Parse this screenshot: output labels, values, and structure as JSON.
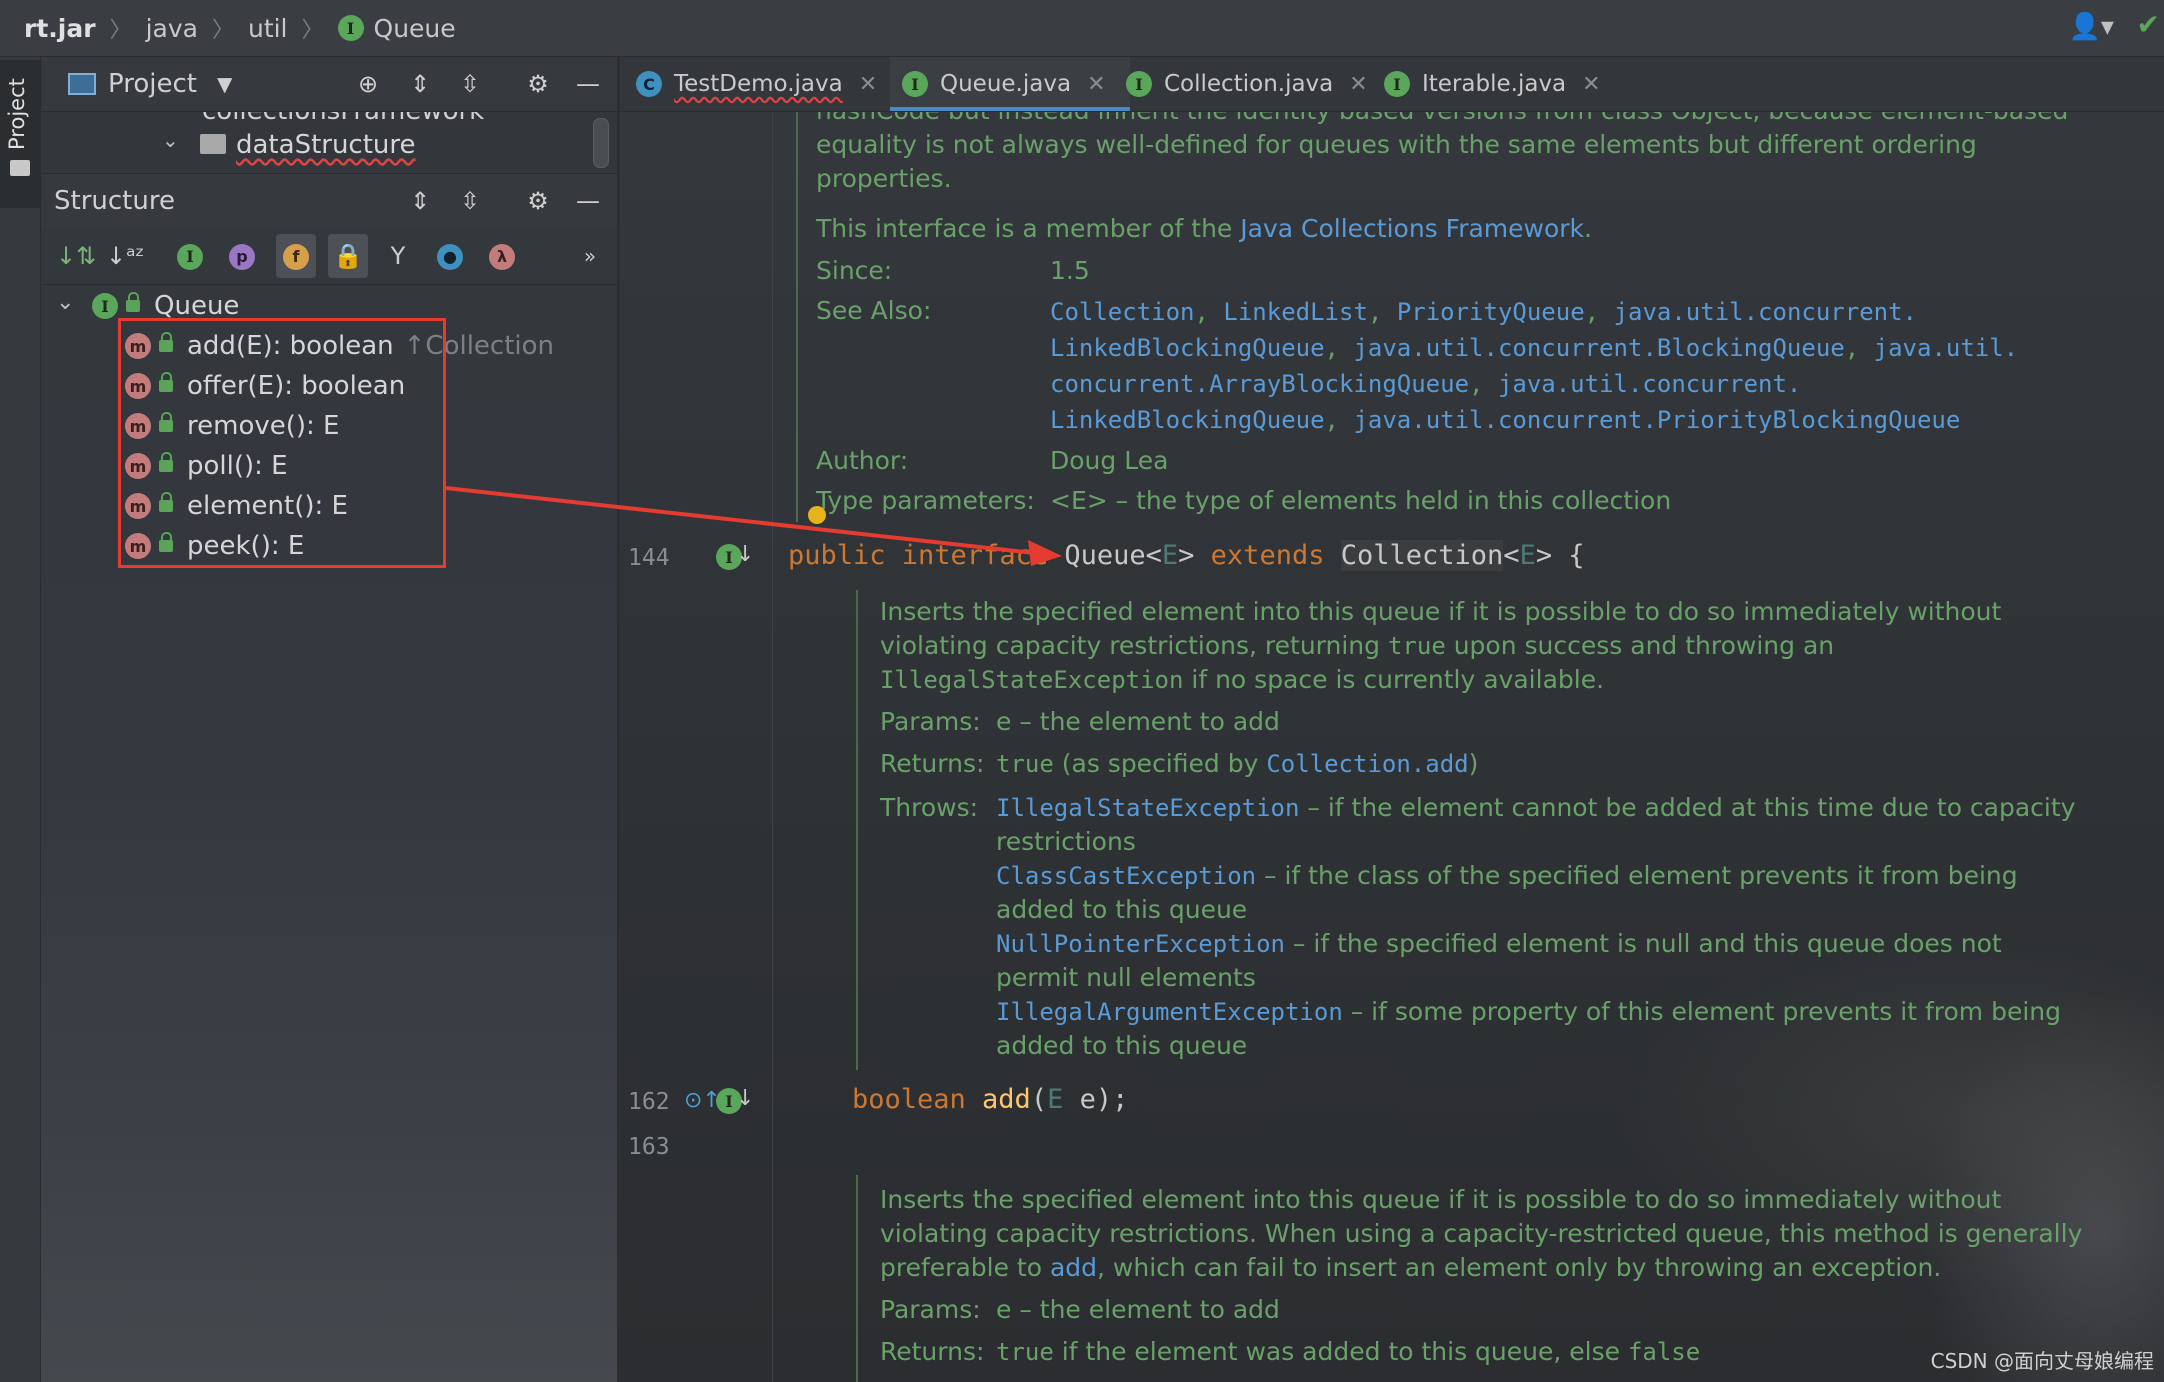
{
  "breadcrumb": {
    "items": [
      "rt.jar",
      "java",
      "util",
      "Queue"
    ]
  },
  "project_panel": {
    "vertical_tab": "Project",
    "title": "Project",
    "tree": {
      "folder_partial": "collectionsFramework",
      "folder": "dataStructure"
    }
  },
  "structure_panel": {
    "title": "Structure",
    "toolbar_icons": [
      "sort-by-visibility-icon",
      "sort-alphabetically-icon",
      "show-inherited-icon",
      "show-properties-icon",
      "show-fields-icon",
      "show-non-public-icon",
      "show-lambdas-tree-icon",
      "anonymous-classes-icon",
      "lambdas-icon",
      "more-icon"
    ],
    "toolbar_glyphs": {
      "props": "p",
      "fields": "f",
      "lambda": "λ"
    },
    "root": "Queue",
    "methods": [
      {
        "sig": "add(E): boolean",
        "inherited": "↑Collection"
      },
      {
        "sig": "offer(E): boolean"
      },
      {
        "sig": "remove(): E"
      },
      {
        "sig": "poll(): E"
      },
      {
        "sig": "element(): E"
      },
      {
        "sig": "peek(): E"
      }
    ]
  },
  "tabs": [
    {
      "label": "TestDemo.java",
      "kind": "C",
      "active": false
    },
    {
      "label": "Queue.java",
      "kind": "I",
      "active": true
    },
    {
      "label": "Collection.java",
      "kind": "I",
      "active": false
    },
    {
      "label": "Iterable.java",
      "kind": "I",
      "active": false
    }
  ],
  "editor": {
    "doc_top": {
      "line1": "hashCode but instead inherit the identity based versions from class Object, because element-based",
      "line2": "equality is not always well-defined for queues with the same elements but different ordering",
      "line3": "properties.",
      "member_prefix": "This interface is a member of the ",
      "member_link": "Java Collections Framework",
      "member_suffix": ".",
      "since_label": "Since:",
      "since_value": "1.5",
      "see_also_label": "See Also:",
      "see_also_1": [
        "Collection",
        "LinkedList",
        "PriorityQueue",
        "java.util.concurrent."
      ],
      "see_also_2": [
        "LinkedBlockingQueue",
        "java.util.concurrent.BlockingQueue",
        "java.util."
      ],
      "see_also_3": [
        "concurrent.ArrayBlockingQueue",
        "java.util.concurrent."
      ],
      "see_also_4": [
        "LinkedBlockingQueue",
        "java.util.concurrent.PriorityBlockingQueue"
      ],
      "sep": ", ",
      "author_label": "Author:",
      "author_value": "Doug Lea",
      "type_params_label": "Type parameters:",
      "type_params_value": "<E> – the type of elements held in this collection"
    },
    "decl_line_no": "144",
    "decl": {
      "kw1": "public interface ",
      "name": "Queue",
      "lt": "<",
      "gen": "E",
      "gt": "> ",
      "kw2": "extends ",
      "parent": "Collection",
      "lt2": "<",
      "gen2": "E",
      "gt2": "> {"
    },
    "doc_add": {
      "l1": "Inserts the specified element into this queue if it is possible to do so immediately without",
      "l2a": "violating capacity restrictions, returning ",
      "l2b": "true",
      "l2c": " upon success and throwing an",
      "l3a": "IllegalStateException",
      "l3b": " if no space is currently available.",
      "params_label": "Params:",
      "params_value": "e – the element to add",
      "returns_label": "Returns:",
      "returns_a": "true",
      "returns_b": " (as specified by ",
      "returns_link": "Collection.add",
      "returns_c": ")",
      "throws_label": "Throws:",
      "t1_link": "IllegalStateException",
      "t1_a": " – if the element cannot be added at this time due to capacity",
      "t1_b": "restrictions",
      "t2_link": "ClassCastException",
      "t2_a": " – if the class of the specified element prevents it from being",
      "t2_b": "added to this queue",
      "t3_link": "NullPointerException",
      "t3_a": " – if the specified element is null and this queue does not",
      "t3_b": "permit null elements",
      "t4_link": "IllegalArgumentException",
      "t4_a": " – if some property of this element prevents it from being",
      "t4_b": "added to this queue"
    },
    "add_line_no": "162",
    "add_code": {
      "kw": "boolean ",
      "fn": "add",
      "open": "(",
      "gen": "E",
      "rest": " e);"
    },
    "empty_line_no": "163",
    "doc_offer": {
      "l1": "Inserts the specified element into this queue if it is possible to do so immediately without",
      "l2": "violating capacity restrictions. When using a capacity-restricted queue, this method is generally",
      "l3a": "preferable to ",
      "l3_link": "add",
      "l3b": ", which can fail to insert an element only by throwing an exception.",
      "params_label": "Params:",
      "params_value": "e – the element to add",
      "returns_label": "Returns:",
      "returns_a": "true",
      "returns_b": " if the element was added to this queue, else ",
      "returns_c": "false"
    }
  },
  "watermark": "CSDN @面向丈母娘编程",
  "colors": {
    "annotation": "#e53b30",
    "keyword": "#cc7832",
    "doc": "#6aa16a",
    "link": "#5a9ad6"
  }
}
